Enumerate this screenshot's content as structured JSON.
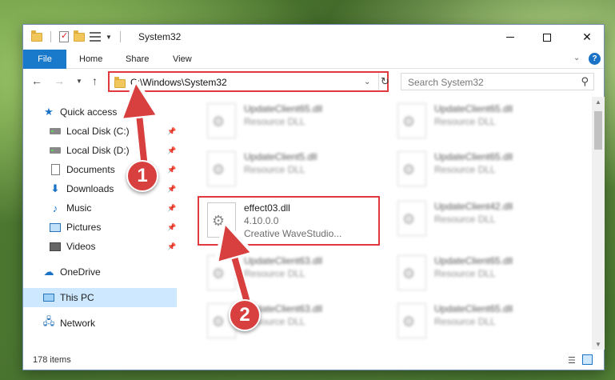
{
  "window": {
    "title": "System32",
    "controls": {
      "minimize": "—",
      "maximize": "□",
      "close": "✕"
    }
  },
  "ribbon": {
    "tabs": [
      "File",
      "Home",
      "Share",
      "View"
    ],
    "help": "?"
  },
  "navigation": {
    "address": "C:\\Windows\\System32",
    "search_placeholder": "Search System32"
  },
  "sidebar": {
    "items": [
      {
        "label": "Quick access",
        "icon": "star-icon"
      },
      {
        "label": "Local Disk (C:)",
        "icon": "disk-icon",
        "pinned": true
      },
      {
        "label": "Local Disk (D:)",
        "icon": "disk-icon",
        "pinned": true
      },
      {
        "label": "Documents",
        "icon": "documents-icon",
        "pinned": true
      },
      {
        "label": "Downloads",
        "icon": "downloads-icon",
        "pinned": true
      },
      {
        "label": "Music",
        "icon": "music-icon",
        "pinned": true
      },
      {
        "label": "Pictures",
        "icon": "pictures-icon",
        "pinned": true
      },
      {
        "label": "Videos",
        "icon": "videos-icon",
        "pinned": true
      },
      {
        "label": "OneDrive",
        "icon": "cloud-icon"
      },
      {
        "label": "This PC",
        "icon": "computer-icon",
        "selected": true
      },
      {
        "label": "Network",
        "icon": "network-icon"
      }
    ]
  },
  "files": [
    {
      "name": "UpdateClient65.dll",
      "desc": "Resource DLL",
      "blurred": true
    },
    {
      "name": "UpdateClient65.dll",
      "desc": "Resource DLL",
      "blurred": true
    },
    {
      "name": "UpdateClient5.dll",
      "desc": "Resource DLL",
      "blurred": true
    },
    {
      "name": "UpdateClient65.dll",
      "desc": "Resource DLL",
      "blurred": true
    },
    {
      "name": "effect03.dll",
      "version": "4.10.0.0",
      "desc": "Creative WaveStudio...",
      "highlighted": true
    },
    {
      "name": "UpdateClient42.dll",
      "desc": "Resource DLL",
      "blurred": true
    },
    {
      "name": "UpdateClient63.dll",
      "desc": "Resource DLL",
      "blurred": true
    },
    {
      "name": "UpdateClient65.dll",
      "desc": "Resource DLL",
      "blurred": true
    },
    {
      "name": "UpdateClient63.dll",
      "desc": "Resource DLL",
      "blurred": true
    },
    {
      "name": "UpdateClient65.dll",
      "desc": "Resource DLL",
      "blurred": true
    }
  ],
  "status": {
    "item_count": "178 items"
  },
  "annotations": {
    "step1": "1",
    "step2": "2",
    "color": "#d8403f"
  }
}
